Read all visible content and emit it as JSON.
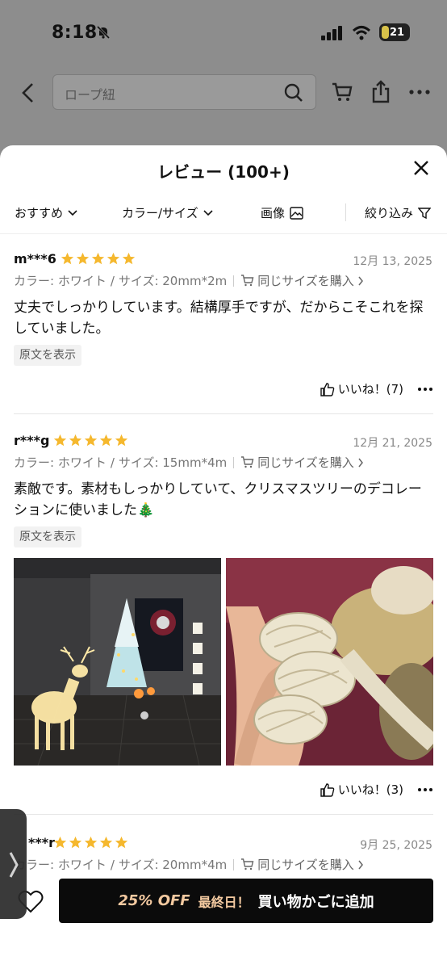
{
  "status_bar": {
    "time": "8:18",
    "battery": "21"
  },
  "top_nav": {
    "search_placeholder": "ロープ紐"
  },
  "sheet": {
    "title": "レビュー (100+)"
  },
  "filters": [
    {
      "label": "おすすめ"
    },
    {
      "label": "カラー/サイズ"
    },
    {
      "label": "画像"
    },
    {
      "label": "絞り込み"
    }
  ],
  "reviews": [
    {
      "user": "m***6",
      "stars": 5,
      "date": "12月 13, 2025",
      "color": "カラー: ホワイト",
      "size": "サイズ: 20mm*2m",
      "buy_same": "同じサイズを購入",
      "text": "丈夫でしっかりしています。結構厚手ですが、だからこそこれを探していました。",
      "show_original": "原文を表示",
      "like": "いいね！(7)"
    },
    {
      "user": "r***g",
      "stars": 5,
      "date": "12月 21, 2025",
      "color": "カラー: ホワイト",
      "size": "サイズ: 15mm*4m",
      "buy_same": "同じサイズを購入",
      "text": "素敵です。素材もしっかりしていて、クリスマスツリーのデコレーションに使いました🎄",
      "show_original": "原文を表示",
      "photos": [
        "christmas-deer-tree-photo",
        "knotted-rope-photo"
      ],
      "like": "いいね！(3)"
    },
    {
      "user": "***r",
      "stars": 5,
      "date": "9月 25, 2025",
      "color": "カラー: ホワイト",
      "size": "サイズ: 20mm*4m",
      "buy_same": "同じサイズを購入"
    }
  ],
  "bottom_bar": {
    "discount": "25% OFF",
    "last_day": "最終日！",
    "add_to_cart": "買い物かごに追加"
  },
  "colors": {
    "star": "#f5b82e",
    "button_bg": "#0b0b0b",
    "discount_text": "#f3c9a0"
  }
}
